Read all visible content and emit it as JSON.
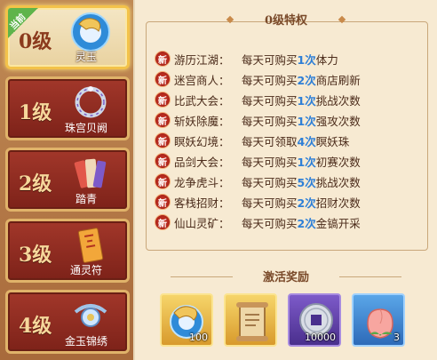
{
  "current_tag": "当前",
  "levels": [
    {
      "label": "0级",
      "reward": "灵玉",
      "icon": "jade-dragon-icon"
    },
    {
      "label": "1级",
      "reward": "珠宫贝阙",
      "icon": "pearl-wreath-icon"
    },
    {
      "label": "2级",
      "reward": "踏青",
      "icon": "scroll-bundle-icon"
    },
    {
      "label": "3级",
      "reward": "通灵符",
      "icon": "talisman-icon"
    },
    {
      "label": "4级",
      "reward": "金玉锦绣",
      "icon": "jade-ornament-icon"
    }
  ],
  "privilege_title": "0级特权",
  "new_badge": "新",
  "privileges": [
    {
      "name": "游历江湖：",
      "pre": "每天可购买",
      "num": "1次",
      "post": "体力"
    },
    {
      "name": "迷宫商人：",
      "pre": "每天可购买",
      "num": "2次",
      "post": "商店刷新"
    },
    {
      "name": "比武大会：",
      "pre": "每天可购买",
      "num": "1次",
      "post": "挑战次数"
    },
    {
      "name": "斩妖除魔：",
      "pre": "每天可购买",
      "num": "1次",
      "post": "强攻次数"
    },
    {
      "name": "瞑妖幻境：",
      "pre": "每天可领取",
      "num": "4次",
      "post": "瞑妖珠"
    },
    {
      "name": "品剑大会：",
      "pre": "每天可购买",
      "num": "1次",
      "post": "初赛次数"
    },
    {
      "name": "龙争虎斗：",
      "pre": "每天可购买",
      "num": "5次",
      "post": "挑战次数"
    },
    {
      "name": "客栈招财：",
      "pre": "每天可购买",
      "num": "2次",
      "post": "招财次数"
    },
    {
      "name": "仙山灵矿：",
      "pre": "每天可购买",
      "num": "2次",
      "post": "金镐开采"
    }
  ],
  "activation_title": "激活奖励",
  "activation_rewards": [
    {
      "icon": "jade-dragon-icon",
      "qty": "100"
    },
    {
      "icon": "scroll-icon",
      "qty": ""
    },
    {
      "icon": "silver-coin-icon",
      "qty": "10000"
    },
    {
      "icon": "peach-icon",
      "qty": "3"
    }
  ],
  "colors": {
    "accent_blue": "#2e7fd6",
    "badge_red": "#c62f22",
    "card_red": "#8e2a1f",
    "gold_border": "#f3c24a"
  }
}
